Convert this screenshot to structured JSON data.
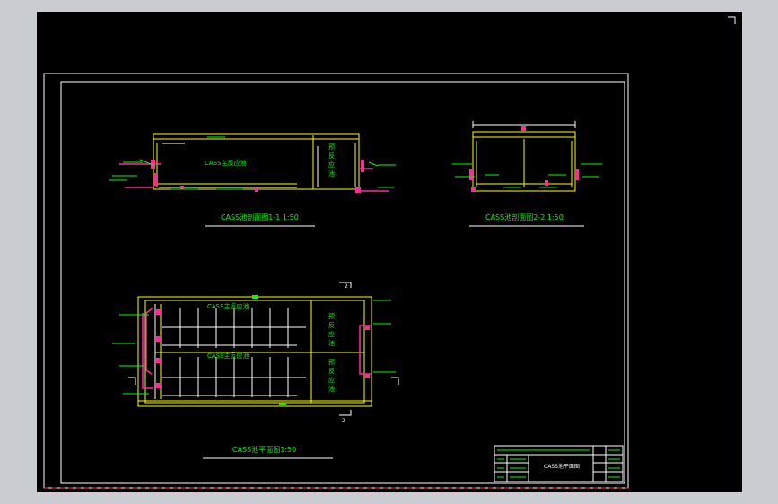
{
  "drawing": {
    "section_1_1": {
      "title": "CASS池剖面图1-1 1:50",
      "main_tank_label": "CASS主反应池",
      "pre_tank_chars": [
        "预",
        "反",
        "应",
        "池"
      ]
    },
    "section_2_2": {
      "title": "CASS池剖面图2-2 1:50"
    },
    "plan": {
      "title": "CASS池平面图1:50",
      "main_tank_label_upper": "CASS主反应池",
      "main_tank_label_lower": "CASS主反应池",
      "pre_tank_chars": [
        "预",
        "反",
        "应",
        "池"
      ],
      "section_mark_top": "2",
      "section_mark_bottom": "2"
    },
    "title_block": {
      "drawing_name": "CASS池平面图"
    }
  },
  "colors": {
    "frame": "#ffffff",
    "outline": "#ffff00",
    "annotation": "#00ff00",
    "pipe": "#ff2aa0",
    "dashed": "#ff3333"
  }
}
